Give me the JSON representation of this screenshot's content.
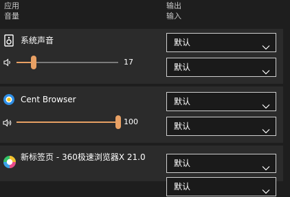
{
  "header": {
    "app_col_line1": "应用",
    "app_col_line2": "音量",
    "out_col_line1": "输出",
    "out_col_line2": "输入"
  },
  "apps": [
    {
      "name": "系统声音",
      "volume_label": "17",
      "volume": 0.17,
      "output": "默认",
      "input": "默认"
    },
    {
      "name": "Cent Browser",
      "volume_label": "100",
      "volume": 1.0,
      "output": "默认",
      "input": "默认"
    },
    {
      "name": "新标签页 - 360极速浏览器X 21.0",
      "output": "默认",
      "input": "默认"
    }
  ],
  "colors": {
    "accent": "#e8a064",
    "background": "#1e1e1e",
    "row_background": "#2b2b2b"
  },
  "icons": {
    "system_sounds": "speaker-device-icon",
    "cent_browser": "cent-browser-icon",
    "browser_360": "360-browser-icon",
    "volume": "speaker-volume-icon",
    "chevron": "chevron-down-icon"
  }
}
